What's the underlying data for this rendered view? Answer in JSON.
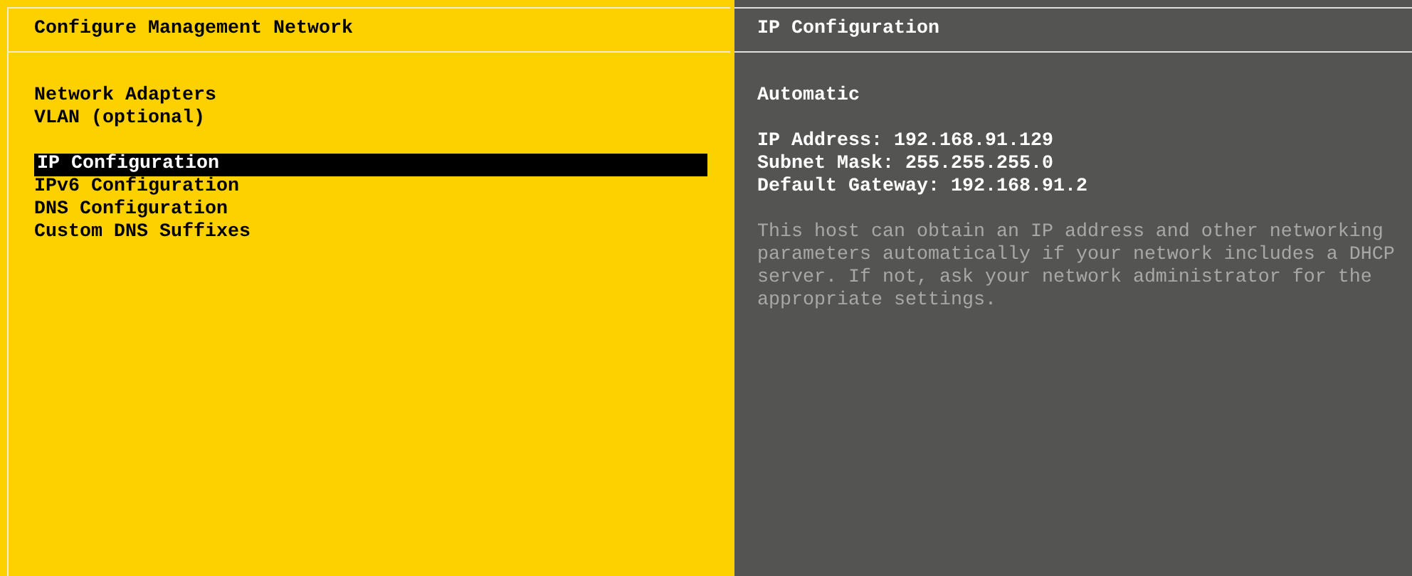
{
  "menu": {
    "title": "Configure Management Network",
    "groups": [
      [
        {
          "label": "Network Adapters",
          "selected": false
        },
        {
          "label": "VLAN (optional)",
          "selected": false
        }
      ],
      [
        {
          "label": "IP Configuration",
          "selected": true
        },
        {
          "label": "IPv6 Configuration",
          "selected": false
        },
        {
          "label": "DNS Configuration",
          "selected": false
        },
        {
          "label": "Custom DNS Suffixes",
          "selected": false
        }
      ]
    ]
  },
  "details": {
    "title": "IP Configuration",
    "mode": "Automatic",
    "fields": [
      "IP Address: 192.168.91.129",
      "Subnet Mask: 255.255.255.0",
      "Default Gateway: 192.168.91.2"
    ],
    "help": "This host can obtain an IP address and other networking parameters automatically if your network includes a DHCP server. If not, ask your network administrator for the appropriate settings."
  }
}
